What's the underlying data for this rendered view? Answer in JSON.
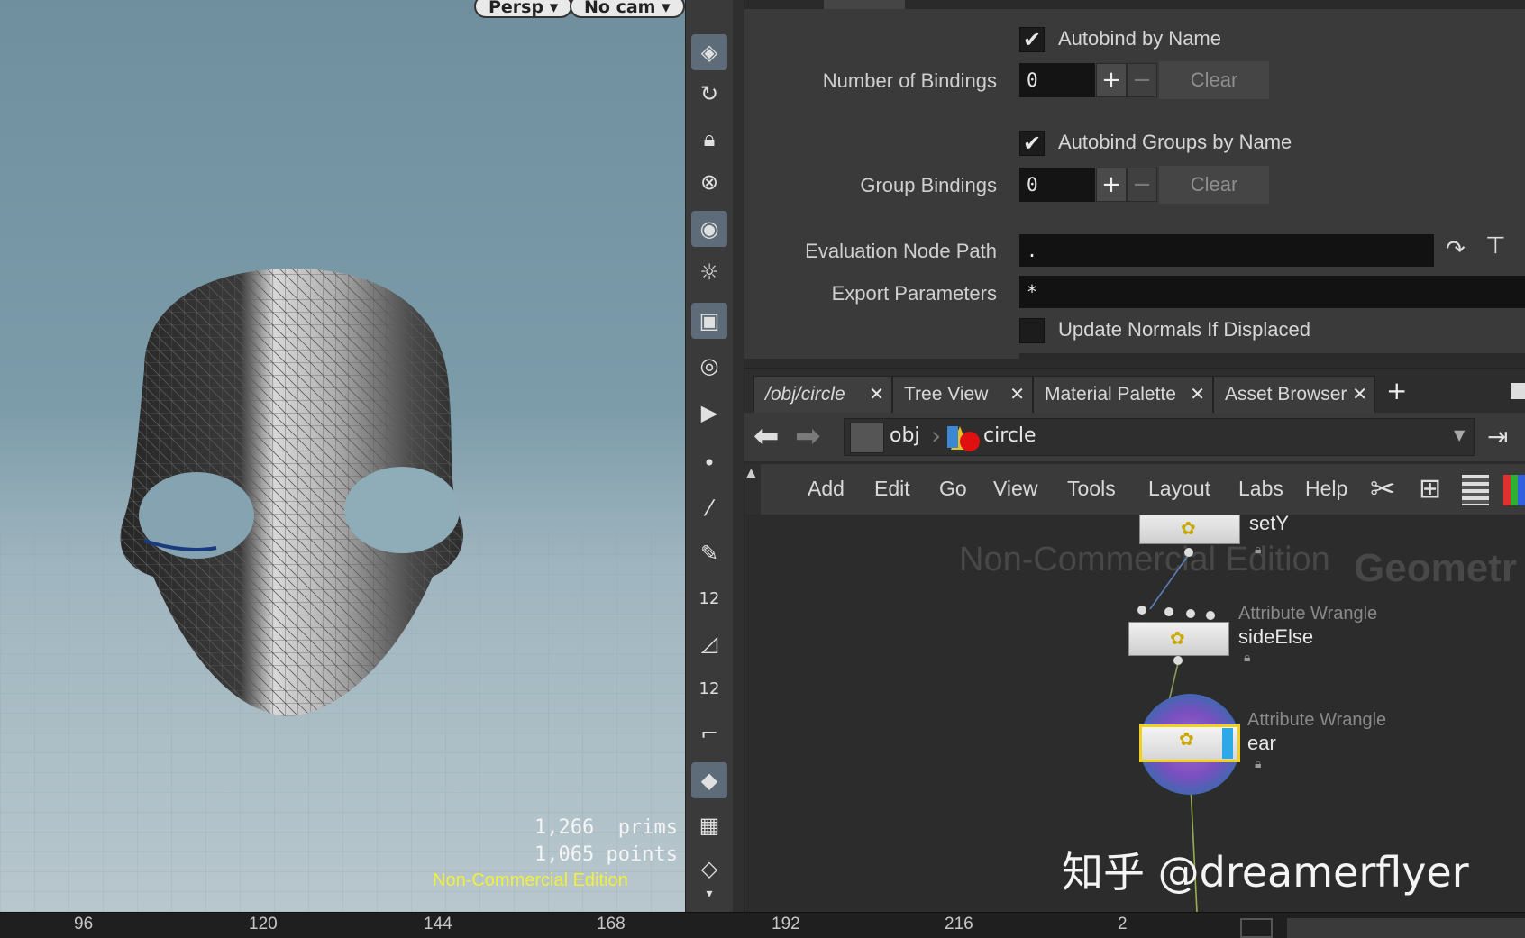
{
  "viewport": {
    "view_label": "Persp",
    "cam_label": "No cam",
    "prims_stat": "1,266  prims",
    "points_stat": "1,065 points",
    "watermark": "Non-Commercial Edition"
  },
  "parameters": {
    "autobind_by_name": {
      "label": "Autobind by Name",
      "checked": true
    },
    "number_of_bindings": {
      "label": "Number of Bindings",
      "value": "0",
      "clear": "Clear"
    },
    "autobind_groups_by_name": {
      "label": "Autobind Groups by Name",
      "checked": true
    },
    "group_bindings": {
      "label": "Group Bindings",
      "value": "0",
      "clear": "Clear"
    },
    "evaluation_node_path": {
      "label": "Evaluation Node Path",
      "value": "."
    },
    "export_parameters": {
      "label": "Export Parameters",
      "value": "*"
    },
    "update_normals": {
      "label": "Update Normals If Displaced",
      "checked": false
    }
  },
  "tabs": [
    {
      "label": "/obj/circle"
    },
    {
      "label": "Tree View"
    },
    {
      "label": "Material Palette"
    },
    {
      "label": "Asset Browser"
    }
  ],
  "path": {
    "root": "obj",
    "node": "circle"
  },
  "menu": [
    "Add",
    "Edit",
    "Go",
    "View",
    "Tools",
    "Layout",
    "Labs",
    "Help"
  ],
  "network": {
    "watermark": "Non-Commercial Edition",
    "context_label": "Geometr",
    "nodes": [
      {
        "type": "",
        "name": "setY"
      },
      {
        "type": "Attribute Wrangle",
        "name": "sideElse"
      },
      {
        "type": "Attribute Wrangle",
        "name": "ear"
      }
    ]
  },
  "overlay_watermark": "知乎 @dreamerflyer",
  "timeline_ticks": [
    "96",
    "120",
    "144",
    "168",
    "192",
    "216",
    "2"
  ]
}
